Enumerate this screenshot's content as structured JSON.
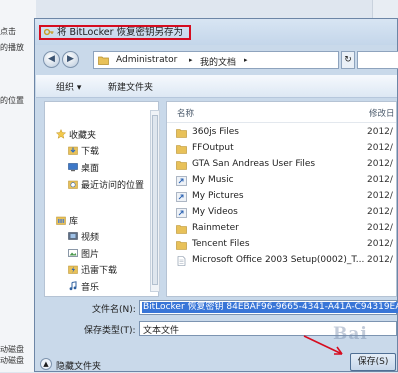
{
  "background": {
    "left_texts": [
      "点击",
      "的播放",
      "的位置",
      "动磁盘",
      "动磁盘"
    ]
  },
  "dialog": {
    "title": "将 BitLocker 恢复密钥另存为",
    "address": {
      "segments": [
        "Administrator",
        "▸",
        "我的文档",
        "▸"
      ]
    },
    "toolbar": {
      "organize": "组织 ▾",
      "new_folder": "新建文件夹"
    },
    "nav": {
      "items": [
        {
          "label": "收藏夹",
          "icon": "star-icon"
        },
        {
          "label": "下载",
          "icon": "download-folder-icon"
        },
        {
          "label": "桌面",
          "icon": "desktop-icon"
        },
        {
          "label": "最近访问的位置",
          "icon": "recent-places-icon"
        },
        {
          "label": "库",
          "icon": "library-icon"
        },
        {
          "label": "视频",
          "icon": "video-library-icon"
        },
        {
          "label": "图片",
          "icon": "pictures-library-icon"
        },
        {
          "label": "迅雷下载",
          "icon": "thunder-download-icon"
        },
        {
          "label": "音乐",
          "icon": "music-library-icon"
        }
      ]
    },
    "files": {
      "headers": {
        "name": "名称",
        "modified": "修改日"
      },
      "rows": [
        {
          "name": "360js Files",
          "date": "2012/",
          "icon": "folder-icon"
        },
        {
          "name": "FFOutput",
          "date": "2012/",
          "icon": "folder-icon"
        },
        {
          "name": "GTA San Andreas User Files",
          "date": "2012/",
          "icon": "folder-icon"
        },
        {
          "name": "My Music",
          "date": "2012/",
          "icon": "shortcut-folder-icon"
        },
        {
          "name": "My Pictures",
          "date": "2012/",
          "icon": "shortcut-folder-icon"
        },
        {
          "name": "My Videos",
          "date": "2012/",
          "icon": "shortcut-folder-icon"
        },
        {
          "name": "Rainmeter",
          "date": "2012/",
          "icon": "folder-icon"
        },
        {
          "name": "Tencent Files",
          "date": "2012/",
          "icon": "folder-icon"
        },
        {
          "name": "Microsoft Office 2003 Setup(0002)_T...",
          "date": "2012/",
          "icon": "text-file-icon"
        }
      ]
    },
    "form": {
      "filename_label": "文件名(N):",
      "filename_value": "BitLocker 恢复密钥 84EBAF96-9665-4341-A41A-C94319EA2A",
      "filetype_label": "保存类型(T):",
      "filetype_value": "文本文件"
    },
    "footer": {
      "hide_folders": "隐藏文件夹",
      "save": "保存(S)"
    }
  },
  "watermark": "Bai",
  "colors": {
    "highlight": "#d60c1f",
    "selection": "#3875d7",
    "folder": "#e8c159"
  }
}
